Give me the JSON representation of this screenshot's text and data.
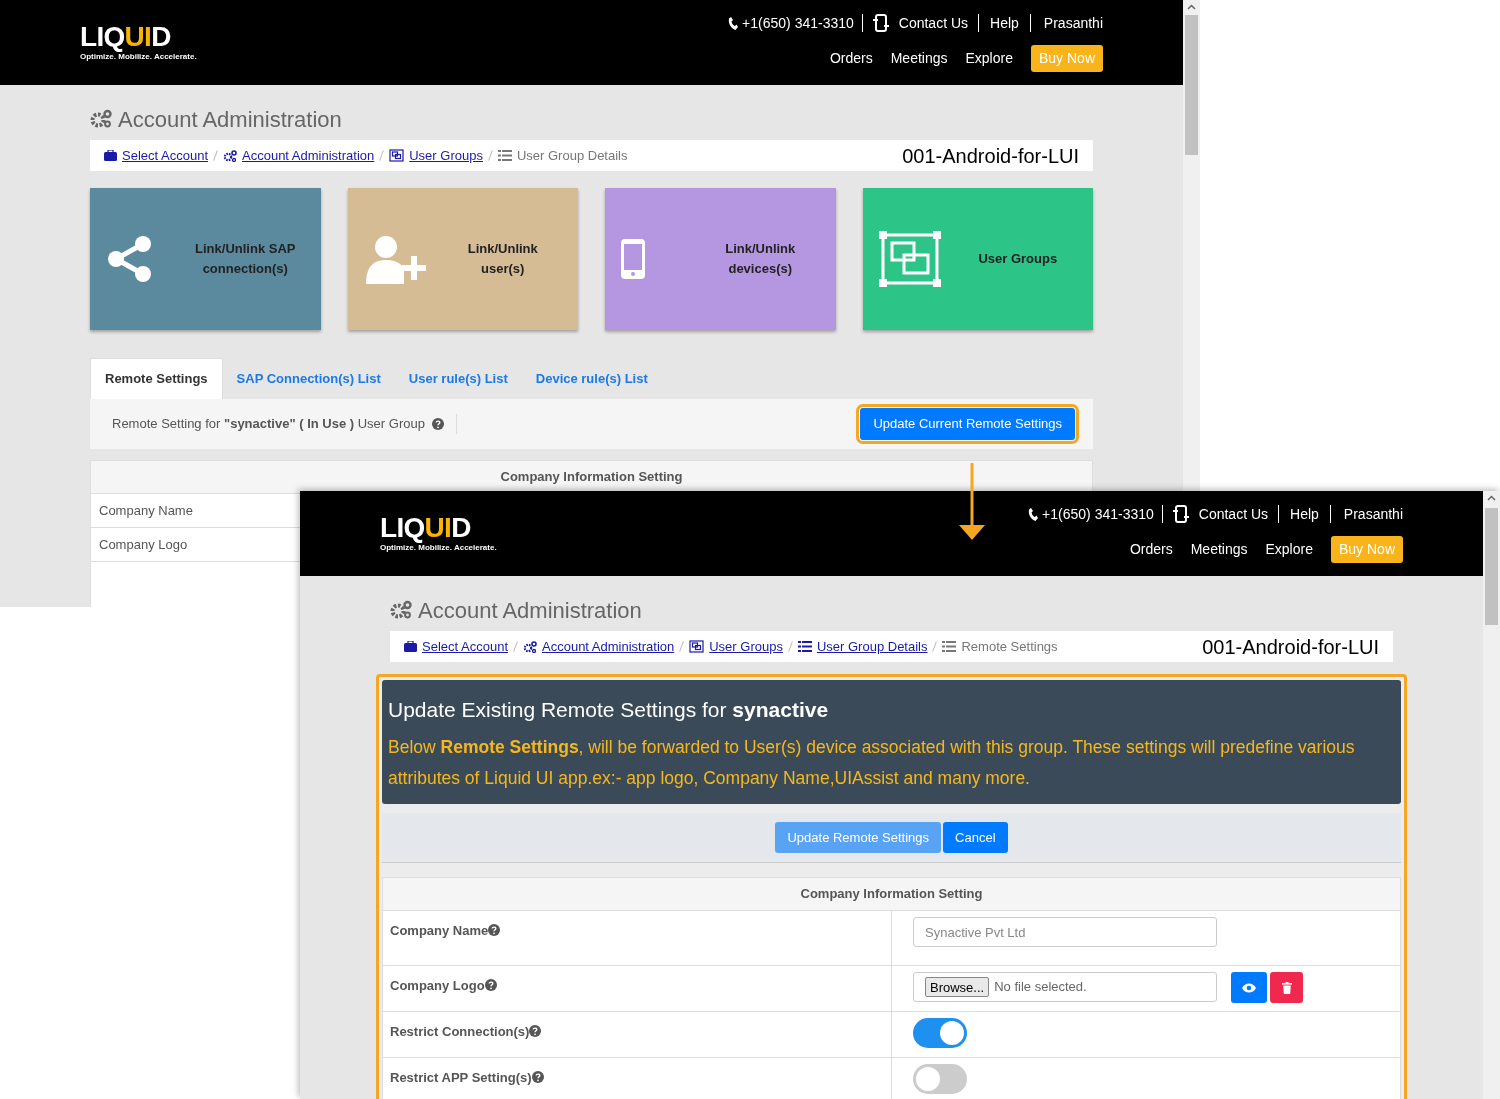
{
  "back_page": {
    "header": {
      "logo": [
        {
          "text": "LIQ",
          "accent": false
        },
        {
          "text": "UI",
          "accent": true
        },
        {
          "text": "D",
          "accent": false
        }
      ],
      "tagline": "Optimize. Mobilize. Accelerate.",
      "phone": "+1(650) 341-3310",
      "contact": "Contact Us",
      "help": "Help",
      "user": "Prasanthi",
      "nav": [
        "Orders",
        "Meetings",
        "Explore"
      ],
      "cta": "Buy Now"
    },
    "title": "Account Administration",
    "breadcrumb": [
      {
        "label": "Select Account",
        "link": true
      },
      {
        "label": "Account Administration",
        "link": true
      },
      {
        "label": "User Groups",
        "link": true
      },
      {
        "label": "User Group Details",
        "link": false
      }
    ],
    "account": "001-Android-for-LUI",
    "tiles": [
      {
        "label": "Link/Unlink SAP connection(s)",
        "color": "#5b8a9e"
      },
      {
        "label": "Link/Unlink user(s)",
        "color": "#d5bc95"
      },
      {
        "label": "Link/Unlink devices(s)",
        "color": "#b497e0"
      },
      {
        "label": "User Groups",
        "color": "#2dc487"
      }
    ],
    "tabs": [
      {
        "label": "Remote Settings",
        "selected": true
      },
      {
        "label": "SAP Connection(s) List",
        "selected": false
      },
      {
        "label": "User rule(s) List",
        "selected": false
      },
      {
        "label": "Device rule(s) List",
        "selected": false
      }
    ],
    "status_bar": {
      "text": "Remote Setting for **\"synactive\" ( In Use )** User Group",
      "button": "Update Current Remote Settings"
    },
    "table": {
      "heading": "Company Information Setting",
      "rows": [
        "Company Name",
        "Company Logo"
      ]
    }
  },
  "front_page": {
    "header": {
      "logo": [
        {
          "text": "LIQ",
          "accent": false
        },
        {
          "text": "UI",
          "accent": true
        },
        {
          "text": "D",
          "accent": false
        }
      ],
      "tagline": "Optimize. Mobilize. Accelerate.",
      "phone": "+1(650) 341-3310",
      "contact": "Contact Us",
      "help": "Help",
      "user": "Prasanthi",
      "nav": [
        "Orders",
        "Meetings",
        "Explore"
      ],
      "cta": "Buy Now"
    },
    "title": "Account Administration",
    "breadcrumb": [
      {
        "label": "Select Account",
        "link": true
      },
      {
        "label": "Account Administration",
        "link": true
      },
      {
        "label": "User Groups",
        "link": true
      },
      {
        "label": "User Group Details",
        "link": true
      },
      {
        "label": "Remote Settings",
        "link": false
      }
    ],
    "account": "001-Android-for-LUI",
    "panel": {
      "heading": "Update Existing Remote Settings for **synactive**",
      "description": "Below **Remote Settings**, will be forwarded to User(s) device associated with this group. These settings will predefine various attributes of Liquid UI app.ex:- app logo, Company Name,UIAssist and many more.",
      "buttons": [
        {
          "label": "Update Remote Settings",
          "disabled": true
        },
        {
          "label": "Cancel",
          "disabled": false
        }
      ]
    },
    "table": {
      "heading": "Company Information Setting",
      "rows": [
        {
          "kind": "text",
          "label": "Company Name",
          "value": "Synactive Pvt Ltd"
        },
        {
          "kind": "file",
          "label": "Company Logo",
          "button": "Browse...",
          "file": "No file selected."
        },
        {
          "kind": "toggle",
          "label": "Restrict Connection(s)",
          "on": true
        },
        {
          "kind": "toggle",
          "label": "Restrict APP Setting(s)",
          "on": false
        }
      ]
    }
  }
}
